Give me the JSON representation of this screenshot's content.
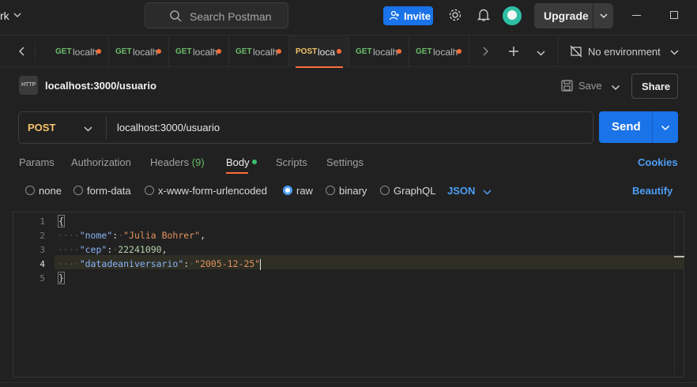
{
  "workspace": {
    "name": "rk"
  },
  "search": {
    "placeholder": "Search Postman"
  },
  "header": {
    "invite_label": "Invite",
    "upgrade_label": "Upgrade"
  },
  "tabs": [
    {
      "method": "GET",
      "name": "localh",
      "active": false
    },
    {
      "method": "GET",
      "name": "localh",
      "active": false
    },
    {
      "method": "GET",
      "name": "localh",
      "active": false
    },
    {
      "method": "GET",
      "name": "localh",
      "active": false
    },
    {
      "method": "POST",
      "name": "localh",
      "active": true
    },
    {
      "method": "GET",
      "name": "localh",
      "active": false
    },
    {
      "method": "GET",
      "name": "localh",
      "active": false
    }
  ],
  "environment": {
    "label": "No environment"
  },
  "request": {
    "icon_text": "HTTP",
    "title": "localhost:3000/usuario",
    "save_label": "Save",
    "share_label": "Share",
    "method": "POST",
    "url": "localhost:3000/usuario",
    "send_label": "Send"
  },
  "request_tabs": {
    "params": "Params",
    "authorization": "Authorization",
    "headers": "Headers",
    "headers_count": "(9)",
    "body": "Body",
    "scripts": "Scripts",
    "settings": "Settings",
    "cookies": "Cookies"
  },
  "body_types": {
    "none": "none",
    "form_data": "form-data",
    "urlencoded": "x-www-form-urlencoded",
    "raw": "raw",
    "binary": "binary",
    "graphql": "GraphQL",
    "format": "JSON",
    "beautify": "Beautify",
    "selected": "raw"
  },
  "editor": {
    "line_numbers": [
      "1",
      "2",
      "3",
      "4",
      "5"
    ],
    "current_line": "4",
    "open_brace": "{",
    "close_brace": "}",
    "fields": [
      {
        "key": "\"nome\"",
        "value": "\"Julia Bohrer\"",
        "trail": ","
      },
      {
        "key": "\"cep\"",
        "value": "22241090",
        "trail": ","
      },
      {
        "key": "\"datadeaniversario\"",
        "value": "\"2005-12-25\"",
        "trail": ""
      }
    ]
  },
  "colors": {
    "accent": "#ff6c37",
    "primary": "#1a73e8",
    "get_method": "#6bbd6b",
    "post_method": "#f5c36b",
    "link": "#4d9ff5"
  }
}
